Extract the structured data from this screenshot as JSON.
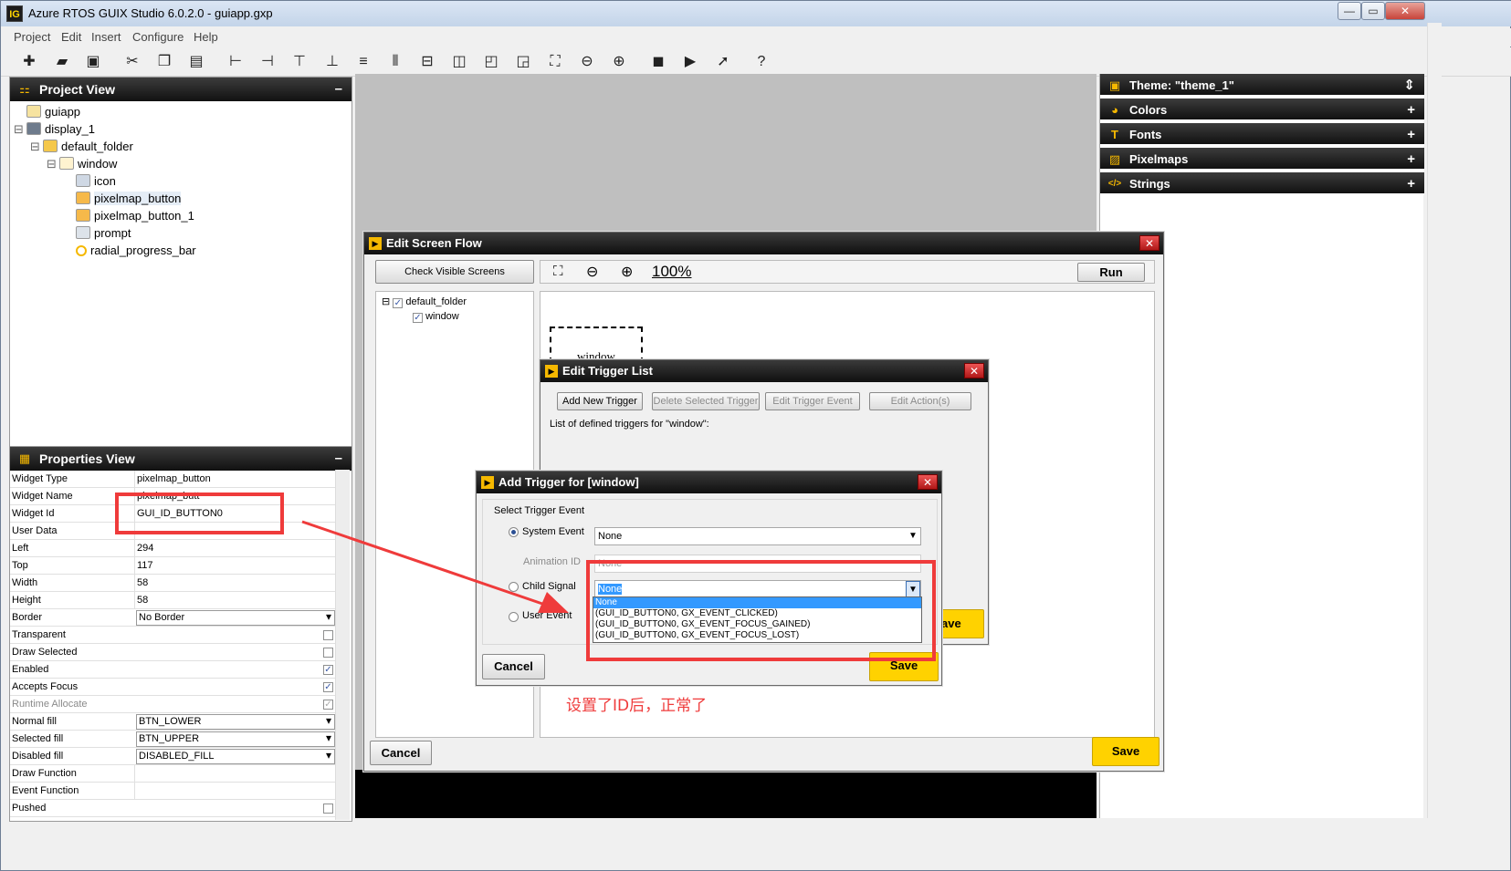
{
  "app": {
    "icon_text": "IG",
    "title": "Azure RTOS GUIX Studio 6.0.2.0 - guiapp.gxp"
  },
  "window_controls": {
    "minimize": "—",
    "restore": "▭",
    "close": "✕"
  },
  "menu": [
    "Project",
    "Edit",
    "Insert",
    "Configure",
    "Help"
  ],
  "toolbar_icons": [
    "new-icon",
    "open-icon",
    "save-icon",
    "cut-icon",
    "copy-icon",
    "paste-icon",
    "align-left-icon",
    "align-right-icon",
    "align-top-icon",
    "align-bottom-icon",
    "v-space-equally-icon",
    "h-space-equally-icon",
    "equal-width-icon",
    "equal-height-icon",
    "move-to-front-icon",
    "move-to-back-icon",
    "size-to-fit-icon",
    "fit-content-icon",
    "zoom-out-icon",
    "zoom-in-icon",
    "macro-record-icon",
    "macro-playback-icon",
    "run-icon",
    "help-icon"
  ],
  "project_view": {
    "title": "Project View",
    "collapse": "–",
    "tree": [
      {
        "label": "guiapp",
        "level": 0,
        "icon": "project-icon"
      },
      {
        "label": "display_1",
        "level": 0,
        "icon": "monitor-icon",
        "expander": "⊟"
      },
      {
        "label": "default_folder",
        "level": 1,
        "icon": "folder-icon",
        "expander": "⊟"
      },
      {
        "label": "window",
        "level": 2,
        "icon": "window-icon",
        "expander": "⊟"
      },
      {
        "label": "icon",
        "level": 3,
        "icon": "icon-widget-icon"
      },
      {
        "label": "pixelmap_button",
        "level": 3,
        "icon": "button-icon",
        "selected": true
      },
      {
        "label": "pixelmap_button_1",
        "level": 3,
        "icon": "button-icon"
      },
      {
        "label": "prompt",
        "level": 3,
        "icon": "prompt-icon"
      },
      {
        "label": "radial_progress_bar",
        "level": 3,
        "icon": "progress-icon"
      }
    ]
  },
  "properties_view": {
    "title": "Properties View",
    "collapse": "–",
    "rows": [
      {
        "name": "Widget Type",
        "value": "pixelmap_button",
        "kind": "text"
      },
      {
        "name": "Widget Name",
        "value": "pixelmap_butt",
        "kind": "text"
      },
      {
        "name": "Widget Id",
        "value": "GUI_ID_BUTTON0",
        "kind": "text"
      },
      {
        "name": "User Data",
        "value": "",
        "kind": "text"
      },
      {
        "name": "Left",
        "value": "294",
        "kind": "text"
      },
      {
        "name": "Top",
        "value": "117",
        "kind": "text"
      },
      {
        "name": "Width",
        "value": "58",
        "kind": "text"
      },
      {
        "name": "Height",
        "value": "58",
        "kind": "text"
      },
      {
        "name": "Border",
        "value": "No Border",
        "kind": "dropdown"
      },
      {
        "name": "Transparent",
        "value": "",
        "kind": "check",
        "checked": false
      },
      {
        "name": "Draw Selected",
        "value": "",
        "kind": "check",
        "checked": false
      },
      {
        "name": "Enabled",
        "value": "",
        "kind": "check",
        "checked": true
      },
      {
        "name": "Accepts Focus",
        "value": "",
        "kind": "check",
        "checked": true
      },
      {
        "name": "Runtime Allocate",
        "value": "",
        "kind": "check",
        "checked": true,
        "disabled": true
      },
      {
        "name": "Normal fill",
        "value": "BTN_LOWER",
        "kind": "dropdown"
      },
      {
        "name": "Selected fill",
        "value": "BTN_UPPER",
        "kind": "dropdown"
      },
      {
        "name": "Disabled fill",
        "value": "DISABLED_FILL",
        "kind": "dropdown"
      },
      {
        "name": "Draw Function",
        "value": "",
        "kind": "text"
      },
      {
        "name": "Event Function",
        "value": "",
        "kind": "text"
      },
      {
        "name": "Pushed",
        "value": "",
        "kind": "check",
        "checked": false
      }
    ]
  },
  "right_panel": {
    "rows": [
      {
        "label": "Theme: \"theme_1\"",
        "icon": "theme-icon",
        "sign": "⇕"
      },
      {
        "label": "Colors",
        "icon": "palette-icon",
        "sign": "+"
      },
      {
        "label": "Fonts",
        "icon": "font-icon",
        "sign": "+"
      },
      {
        "label": "Pixelmaps",
        "icon": "image-icon",
        "sign": "+"
      },
      {
        "label": "Strings",
        "icon": "code-icon",
        "sign": "+"
      }
    ]
  },
  "screen_flow": {
    "title": "Edit Screen Flow",
    "close": "✕",
    "check_visible": "Check Visible Screens",
    "zoom_level": "100%",
    "run_label": "Run",
    "tree": [
      {
        "label": "default_folder",
        "checked": true,
        "expander": "⊟"
      },
      {
        "label": "window",
        "checked": true
      }
    ],
    "screen_label": "window",
    "cancel": "Cancel",
    "save": "Save"
  },
  "trigger_list": {
    "title": "Edit Trigger List",
    "close": "✕",
    "add_new": "Add New Trigger",
    "delete_selected": "Delete Selected Trigger",
    "edit_event": "Edit Trigger Event",
    "edit_actions": "Edit Action(s)",
    "list_caption": "List of defined triggers for \"window\":",
    "save_partial": "ave"
  },
  "add_trigger": {
    "title": "Add Trigger for [window]",
    "close": "✕",
    "group_label": "Select Trigger Event",
    "system_event_label": "System Event",
    "system_event_value": "None",
    "animation_id_label": "Animation ID",
    "animation_id_value": "None",
    "child_signal_label": "Child Signal",
    "child_signal_value": "None",
    "user_event_label": "User Event",
    "dropdown_options": [
      "None",
      "(GUI_ID_BUTTON0, GX_EVENT_CLICKED)",
      "(GUI_ID_BUTTON0, GX_EVENT_FOCUS_GAINED)",
      "(GUI_ID_BUTTON0, GX_EVENT_FOCUS_LOST)"
    ],
    "cancel": "Cancel",
    "save": "Save"
  },
  "annotation": {
    "note": "设置了ID后，正常了",
    "color": "#ef3b3b"
  }
}
